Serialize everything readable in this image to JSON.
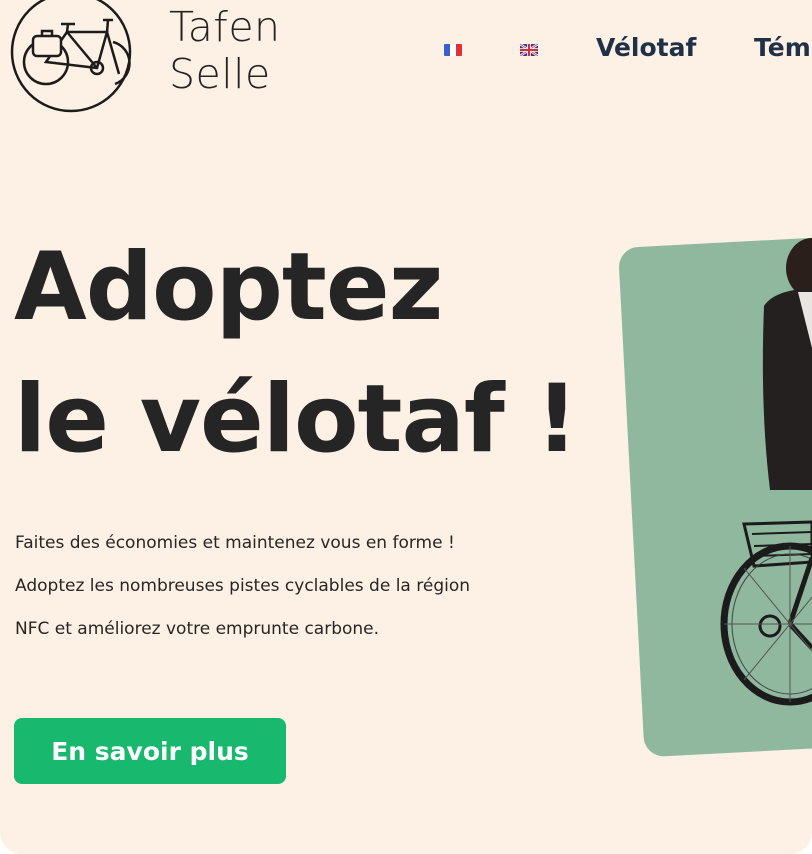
{
  "header": {
    "brand_line1": "Tafen",
    "brand_line2": "Selle",
    "nav": {
      "velotaf": "Vélotaf",
      "temoignages": "Tém"
    },
    "icons": [
      "bicycle-logo-icon",
      "french-flag-icon",
      "english-flag-icon"
    ]
  },
  "hero": {
    "title_line1": "Adoptez",
    "title_line2": "le vélotaf !",
    "text_line1": "Faites des économies et maintenez vous en forme !",
    "text_line2": "Adoptez les nombreuses pistes cyclables de la région",
    "text_line3": "NFC et améliorez votre emprunte carbone.",
    "cta_label": "En savoir plus"
  },
  "colors": {
    "background": "#fdf0e4",
    "accent_green": "#18b96e",
    "card_green": "#8fb89f",
    "nav_text": "#1f3047"
  }
}
